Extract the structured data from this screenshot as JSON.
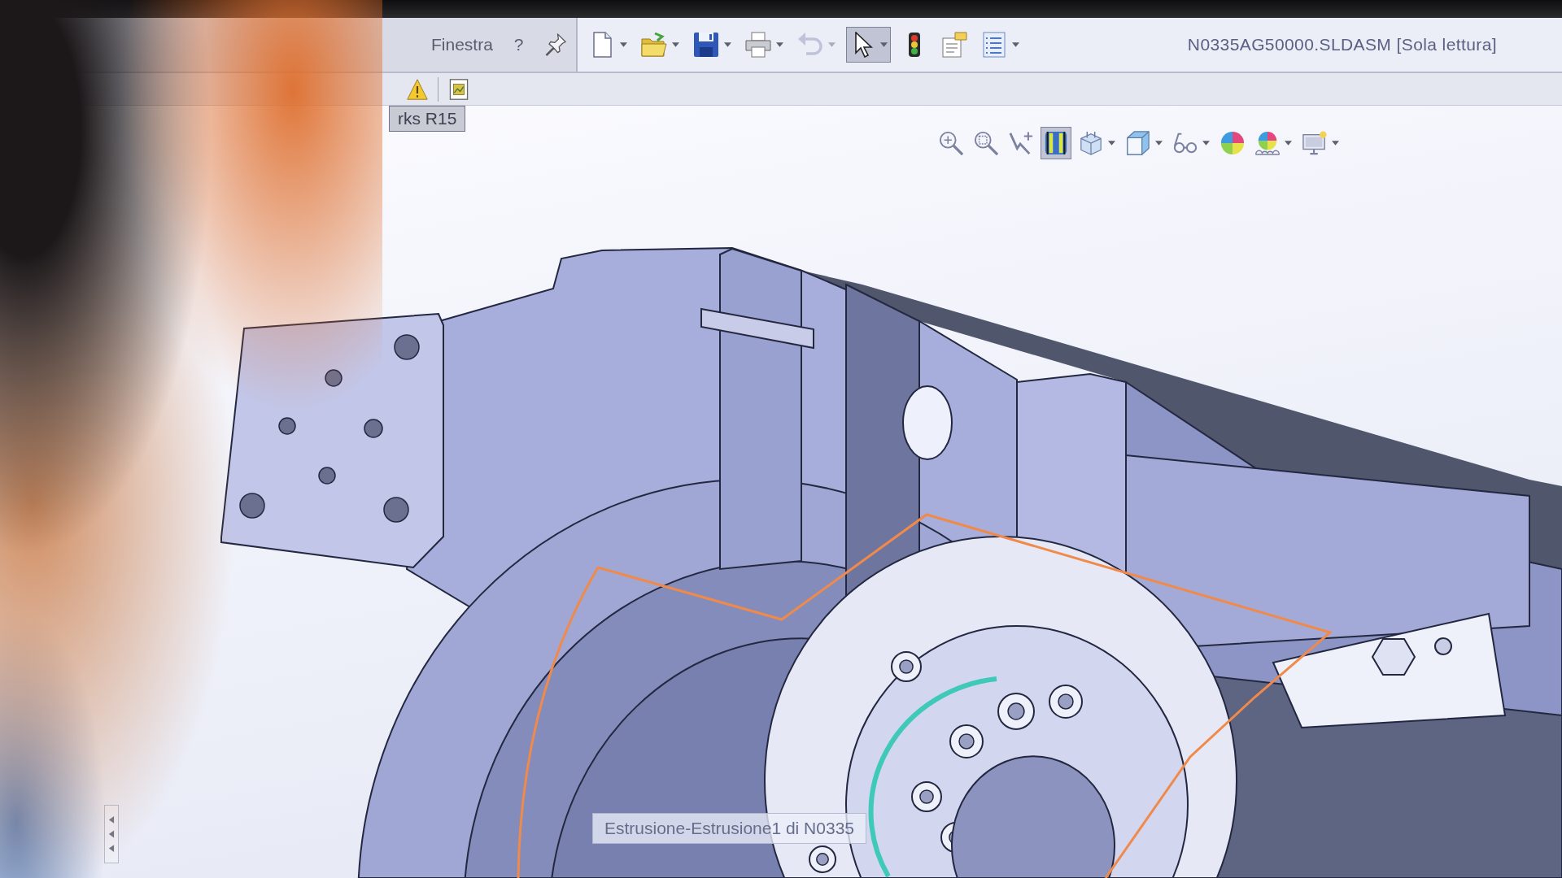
{
  "menu_bar": {
    "items": [
      {
        "label": "Finestra"
      },
      {
        "label": "?"
      }
    ]
  },
  "standard_toolbar": {
    "buttons": [
      {
        "dropdown": true,
        "selected": false,
        "disabled": false
      },
      {
        "dropdown": true,
        "selected": false,
        "disabled": false
      },
      {
        "dropdown": true,
        "selected": false,
        "disabled": false
      },
      {
        "dropdown": true,
        "selected": false,
        "disabled": false
      },
      {
        "dropdown": true,
        "selected": false,
        "disabled": true
      },
      {
        "dropdown": true,
        "selected": true,
        "disabled": false
      },
      {
        "dropdown": false,
        "selected": false,
        "disabled": false
      },
      {
        "dropdown": false,
        "selected": false,
        "disabled": false
      },
      {
        "dropdown": true,
        "selected": false,
        "disabled": false
      }
    ]
  },
  "document_title": "N0335AG50000.SLDASM [Sola lettura]",
  "document_tabs": [
    {
      "label": "rks R15",
      "selected": true
    }
  ],
  "view_toolbar": {
    "buttons": [
      {
        "dropdown": false,
        "selected": false
      },
      {
        "dropdown": false,
        "selected": false
      },
      {
        "dropdown": false,
        "selected": false
      },
      {
        "dropdown": false,
        "selected": true
      },
      {
        "dropdown": true,
        "selected": false
      },
      {
        "dropdown": true,
        "selected": false
      },
      {
        "dropdown": true,
        "selected": false
      },
      {
        "dropdown": false,
        "selected": false
      },
      {
        "dropdown": true,
        "selected": false
      },
      {
        "dropdown": true,
        "selected": false
      }
    ]
  },
  "tooltip": {
    "text": "Estrusione-Estrusione1 di N0335"
  }
}
